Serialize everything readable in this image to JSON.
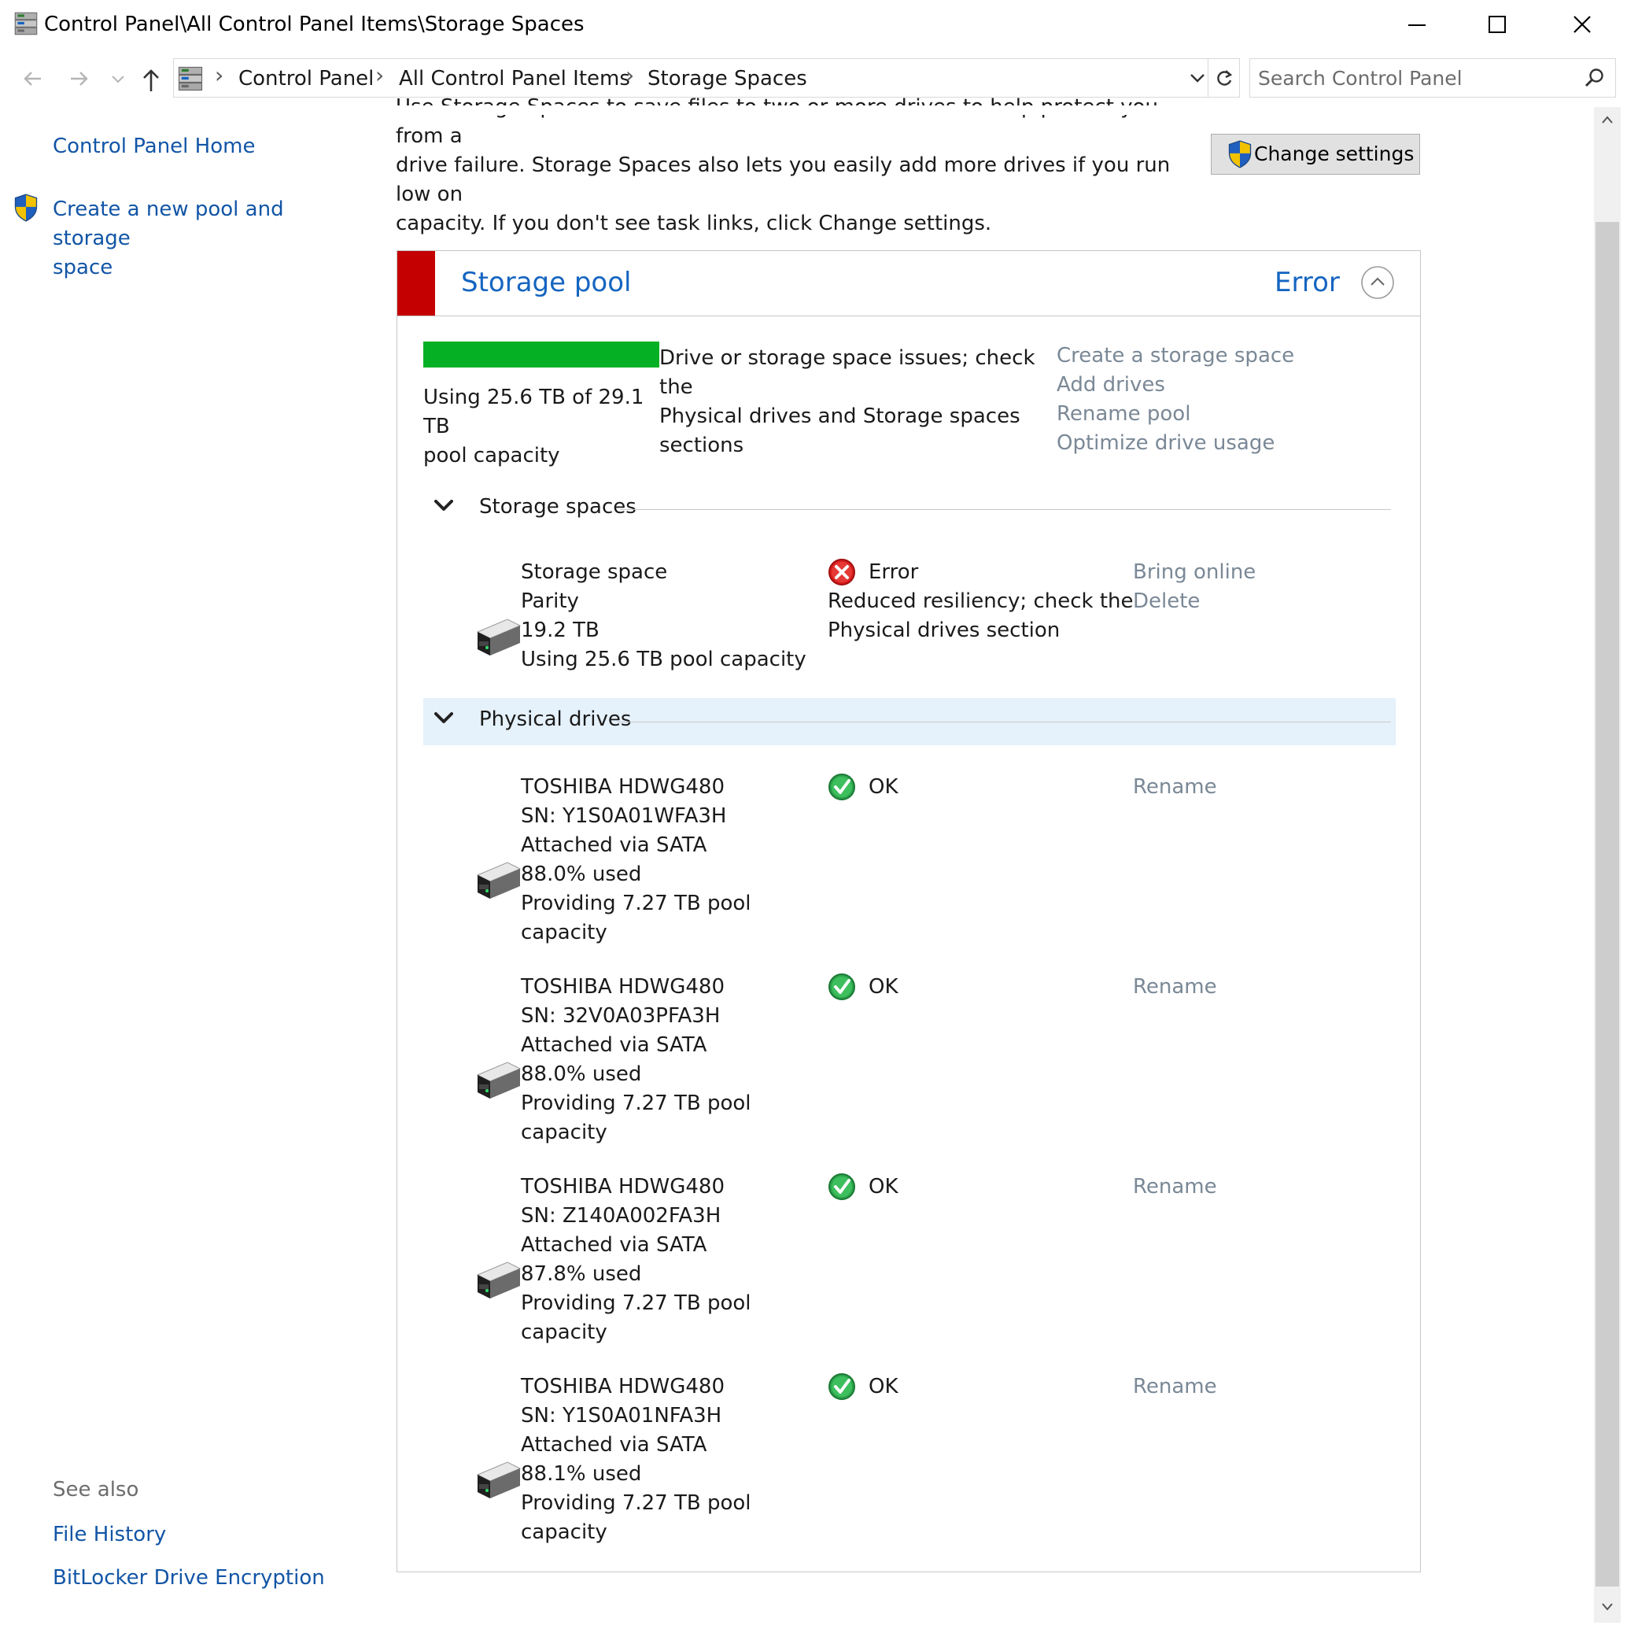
{
  "window": {
    "title": "Control Panel\\All Control Panel Items\\Storage Spaces"
  },
  "address": {
    "breadcrumbs": [
      "Control Panel",
      "All Control Panel Items",
      "Storage Spaces"
    ],
    "search_placeholder": "Search Control Panel"
  },
  "sidebar": {
    "home": "Control Panel Home",
    "create_pool_line1": "Create a new pool and storage",
    "create_pool_line2": "space",
    "see_also": "See also",
    "see_also_links": [
      "File History",
      "BitLocker Drive Encryption"
    ]
  },
  "intro": {
    "line1": "Use Storage Spaces to save files to two or more drives to help protect you from a",
    "line2": "drive failure. Storage Spaces also lets you easily add more drives if you run low on",
    "line3": "capacity. If you don't see task links, click Change settings."
  },
  "change_settings_label": "Change settings",
  "pool": {
    "title": "Storage pool",
    "status": "Error",
    "used_fraction": 1.0,
    "capacity_line1": "Using 25.6 TB of 29.1 TB",
    "capacity_line2": "pool capacity",
    "message_line1": "Drive or storage space issues; check the",
    "message_line2": "Physical drives and Storage spaces",
    "message_line3": "sections",
    "tasks": [
      "Create a storage space",
      "Add drives",
      "Rename pool",
      "Optimize drive usage"
    ]
  },
  "storage_spaces": {
    "header": "Storage spaces",
    "space": {
      "name": "Storage space",
      "resiliency": "Parity",
      "size": "19.2 TB",
      "usage": "Using 25.6 TB pool capacity",
      "status": "Error",
      "status_detail_line1": "Reduced resiliency; check the",
      "status_detail_line2": "Physical drives section",
      "actions": [
        "Bring online",
        "Delete"
      ]
    }
  },
  "physical_drives": {
    "header": "Physical drives",
    "drives": [
      {
        "model": "TOSHIBA HDWG480",
        "serial": "SN: Y1S0A01WFA3H",
        "connection": "Attached via SATA",
        "used": "88.0% used",
        "providing_line1": "Providing 7.27 TB pool",
        "providing_line2": "capacity",
        "status": "OK",
        "action": "Rename"
      },
      {
        "model": "TOSHIBA HDWG480",
        "serial": "SN: 32V0A03PFA3H",
        "connection": "Attached via SATA",
        "used": "88.0% used",
        "providing_line1": "Providing 7.27 TB pool",
        "providing_line2": "capacity",
        "status": "OK",
        "action": "Rename"
      },
      {
        "model": "TOSHIBA HDWG480",
        "serial": "SN: Z140A002FA3H",
        "connection": "Attached via SATA",
        "used": "87.8% used",
        "providing_line1": "Providing 7.27 TB pool",
        "providing_line2": "capacity",
        "status": "OK",
        "action": "Rename"
      },
      {
        "model": "TOSHIBA HDWG480",
        "serial": "SN: Y1S0A01NFA3H",
        "connection": "Attached via SATA",
        "used": "88.1% used",
        "providing_line1": "Providing 7.27 TB pool",
        "providing_line2": "capacity",
        "status": "OK",
        "action": "Rename"
      }
    ]
  },
  "colors": {
    "link_blue": "#1565c0",
    "error_red": "#c40000",
    "capacity_green": "#06b025",
    "task_gray": "#7a8896",
    "selected_section": "#e5f1fb"
  },
  "icons": {
    "title": "control-panel-icon",
    "shield": "uac-shield-icon",
    "drive": "hard-drive-icon",
    "error": "error-x-icon",
    "ok": "ok-check-icon"
  }
}
